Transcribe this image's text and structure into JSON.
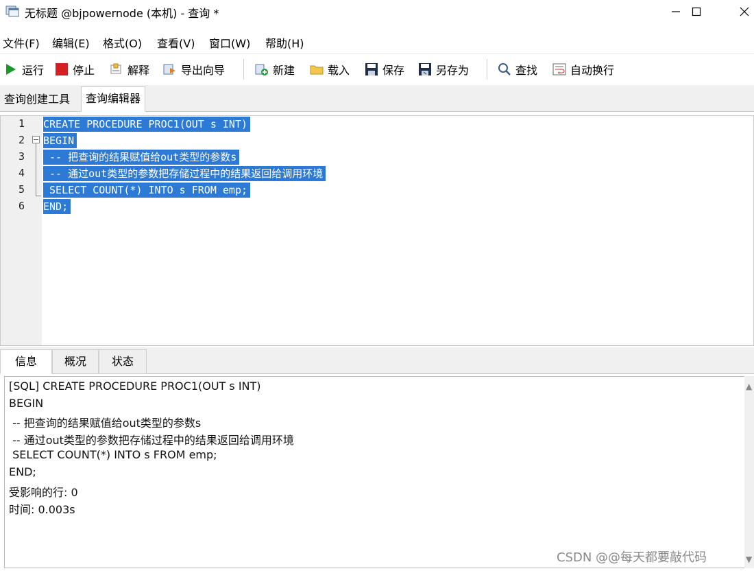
{
  "window": {
    "title": "无标题 @bjpowernode (本机) - 查询 *",
    "minimize": "—",
    "maximize": "☐",
    "close": "✕"
  },
  "menu": [
    "文件(F)",
    "编辑(E)",
    "格式(O)",
    "查看(V)",
    "窗口(W)",
    "帮助(H)"
  ],
  "toolbar": {
    "run": "运行",
    "stop": "停止",
    "explain": "解释",
    "export_wizard": "导出向导",
    "new": "新建",
    "load": "载入",
    "save": "保存",
    "save_as": "另存为",
    "find": "查找",
    "word_wrap": "自动换行"
  },
  "editor_tabs": [
    "查询创建工具",
    "查询编辑器"
  ],
  "editor": {
    "line_numbers": [
      "1",
      "2",
      "3",
      "4",
      "5",
      "6"
    ],
    "lines": [
      "CREATE PROCEDURE PROC1(OUT s INT)",
      "BEGIN",
      " -- 把查询的结果赋值给out类型的参数s",
      " -- 通过out类型的参数把存储过程中的结果返回给调用环境",
      " SELECT COUNT(*) INTO s FROM emp;",
      "END;"
    ]
  },
  "result_tabs": [
    "信息",
    "概况",
    "状态"
  ],
  "result_lines": [
    "[SQL] CREATE PROCEDURE PROC1(OUT s INT)",
    "BEGIN",
    " -- 把查询的结果赋值给out类型的参数s",
    " -- 通过out类型的参数把存储过程中的结果返回给调用环境",
    " SELECT COUNT(*) INTO s FROM emp;",
    "END;",
    "受影响的行: 0",
    "时间: 0.003s"
  ],
  "watermark": "CSDN @@每天都要敲代码",
  "colors": {
    "selection": "#2c7ad6",
    "run_green": "#1a9a2a",
    "stop_red": "#d42020"
  }
}
